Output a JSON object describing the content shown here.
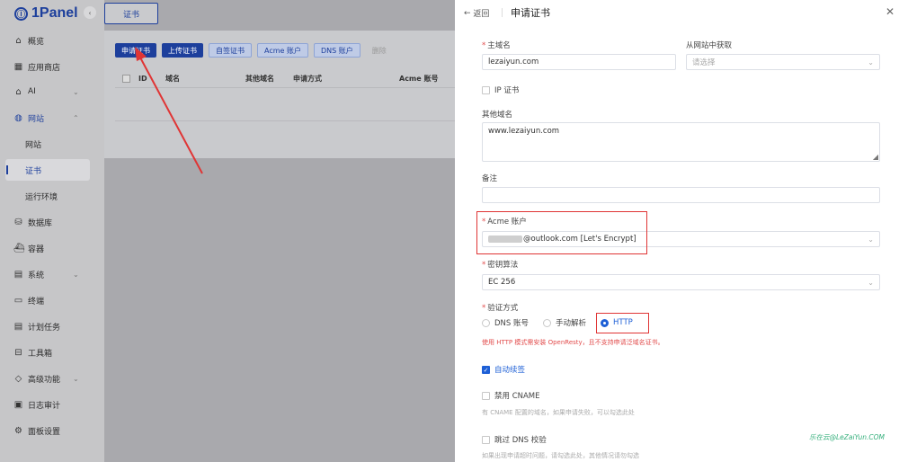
{
  "app": {
    "logo_text": "1Panel",
    "logo_mark": "Ⓘ"
  },
  "sidebar": {
    "items": [
      {
        "label": "概览",
        "icon": "home-icon"
      },
      {
        "label": "应用商店",
        "icon": "grid-icon"
      },
      {
        "label": "AI",
        "icon": "robot-icon"
      },
      {
        "label": "网站",
        "icon": "globe-icon"
      },
      {
        "label": "网站",
        "icon": ""
      },
      {
        "label": "证书",
        "icon": ""
      },
      {
        "label": "运行环境",
        "icon": ""
      },
      {
        "label": "数据库",
        "icon": "database-icon"
      },
      {
        "label": "容器",
        "icon": "container-icon"
      },
      {
        "label": "系统",
        "icon": "system-icon"
      },
      {
        "label": "终端",
        "icon": "terminal-icon"
      },
      {
        "label": "计划任务",
        "icon": "schedule-icon"
      },
      {
        "label": "工具箱",
        "icon": "toolbox-icon"
      },
      {
        "label": "高级功能",
        "icon": "diamond-icon"
      },
      {
        "label": "日志审计",
        "icon": "log-icon"
      },
      {
        "label": "面板设置",
        "icon": "settings-icon"
      }
    ]
  },
  "main": {
    "tab": "证书",
    "toolbar": {
      "apply": "申请证书",
      "upload": "上传证书",
      "self_signed": "自签证书",
      "acme": "Acme 账户",
      "dns": "DNS 账户",
      "delete": "删除"
    },
    "table_headers": [
      "ID",
      "域名",
      "其他域名",
      "申请方式",
      "Acme 账号"
    ]
  },
  "drawer": {
    "back": "返回",
    "title": "申请证书",
    "primary_domain_label": "主域名",
    "primary_domain_value": "lezaiyun.com",
    "from_website_label": "从网站中获取",
    "from_website_placeholder": "请选择",
    "ip_cert_label": "IP 证书",
    "other_domains_label": "其他域名",
    "other_domains_value": "www.lezaiyun.com",
    "remark_label": "备注",
    "acme_label": "Acme 账户",
    "acme_value": "@outlook.com [Let's Encrypt]",
    "key_algo_label": "密钥算法",
    "key_algo_value": "EC 256",
    "verify_label": "验证方式",
    "verify_options": [
      "DNS 账号",
      "手动解析",
      "HTTP"
    ],
    "verify_warning": "使用 HTTP 模式需安装 OpenResty，且不支持申请泛域名证书。",
    "auto_renew_label": "自动续签",
    "disable_cname_label": "禁用 CNAME",
    "disable_cname_hint": "有 CNAME 配置的域名，如果申请失败，可以勾选此处",
    "skip_dns_label": "跳过 DNS 校验",
    "skip_dns_hint": "如果出现申请超时问题，请勾选此处，其他情况请勿勾选"
  },
  "watermark": "乐在云@LeZaiYun.COM",
  "colors": {
    "brand": "#1d3f9c",
    "accent": "#1d5fd6",
    "danger": "#e03535"
  }
}
